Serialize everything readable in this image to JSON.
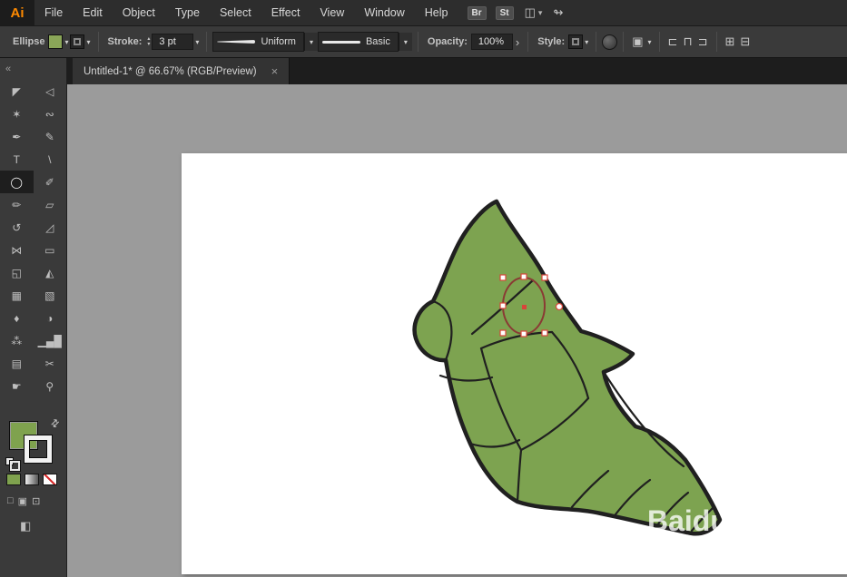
{
  "menu_bar": {
    "logo": "Ai",
    "items": [
      "File",
      "Edit",
      "Object",
      "Type",
      "Select",
      "Effect",
      "View",
      "Window",
      "Help"
    ],
    "bridge_button": "Br",
    "stock_button": "St"
  },
  "control_bar": {
    "tool_context": "Ellipse",
    "stroke_label": "Stroke:",
    "stroke_weight": "3 pt",
    "width_profile": "Uniform",
    "brush_definition": "Basic",
    "opacity_label": "Opacity:",
    "opacity_value": "100%",
    "style_label": "Style:"
  },
  "document_tab": {
    "title": "Untitled-1* @ 66.67% (RGB/Preview)",
    "close_glyph": "×"
  },
  "tool_panel": {
    "collapse_glyph": "«",
    "tools": [
      {
        "name": "selection-tool",
        "glyph": "◤"
      },
      {
        "name": "direct-selection-tool",
        "glyph": "◁"
      },
      {
        "name": "magic-wand-tool",
        "glyph": "✶"
      },
      {
        "name": "lasso-tool",
        "glyph": "∾"
      },
      {
        "name": "pen-tool",
        "glyph": "✒"
      },
      {
        "name": "curvature-tool",
        "glyph": "✎"
      },
      {
        "name": "type-tool",
        "glyph": "T"
      },
      {
        "name": "line-segment-tool",
        "glyph": "\\"
      },
      {
        "name": "ellipse-tool",
        "glyph": "◯"
      },
      {
        "name": "paintbrush-tool",
        "glyph": "✐"
      },
      {
        "name": "pencil-tool",
        "glyph": "✏"
      },
      {
        "name": "eraser-tool",
        "glyph": "▱"
      },
      {
        "name": "rotate-tool",
        "glyph": "↺"
      },
      {
        "name": "scale-tool",
        "glyph": "◿"
      },
      {
        "name": "width-tool",
        "glyph": "⋈"
      },
      {
        "name": "free-transform-tool",
        "glyph": "▭"
      },
      {
        "name": "shape-builder-tool",
        "glyph": "◱"
      },
      {
        "name": "perspective-grid-tool",
        "glyph": "◭"
      },
      {
        "name": "mesh-tool",
        "glyph": "▦"
      },
      {
        "name": "gradient-tool",
        "glyph": "▧"
      },
      {
        "name": "eyedropper-tool",
        "glyph": "♦"
      },
      {
        "name": "blend-tool",
        "glyph": "◑"
      },
      {
        "name": "symbol-sprayer-tool",
        "glyph": "⁂"
      },
      {
        "name": "column-graph-tool",
        "glyph": "▁▄█"
      },
      {
        "name": "artboard-tool",
        "glyph": "▤"
      },
      {
        "name": "slice-tool",
        "glyph": "✂"
      },
      {
        "name": "hand-tool",
        "glyph": "☛"
      },
      {
        "name": "zoom-tool",
        "glyph": "⚲"
      }
    ]
  },
  "icons": {
    "chevron_down": "▾",
    "chevron_right": "›",
    "stepper_up": "▴",
    "stepper_down": "▾",
    "swap_arrows": "⇄",
    "workspace": "◫",
    "swirl": "↬",
    "transform": "▣",
    "align_left": "⊏",
    "align_center": "⊓",
    "align_right": "⊐",
    "panel_a": "⊞",
    "panel_b": "⊟",
    "mode_normal": "□",
    "mode_behind": "▣",
    "mode_inside": "⊡",
    "screen_mode": "◧"
  },
  "watermark": {
    "text": "Baidu"
  },
  "colors": {
    "fill_green": "#7fa24e",
    "shape_green": "#7da350",
    "outline_dark": "#202020",
    "selection_red": "#d8453a",
    "canvas_gray": "#9b9b9b"
  }
}
